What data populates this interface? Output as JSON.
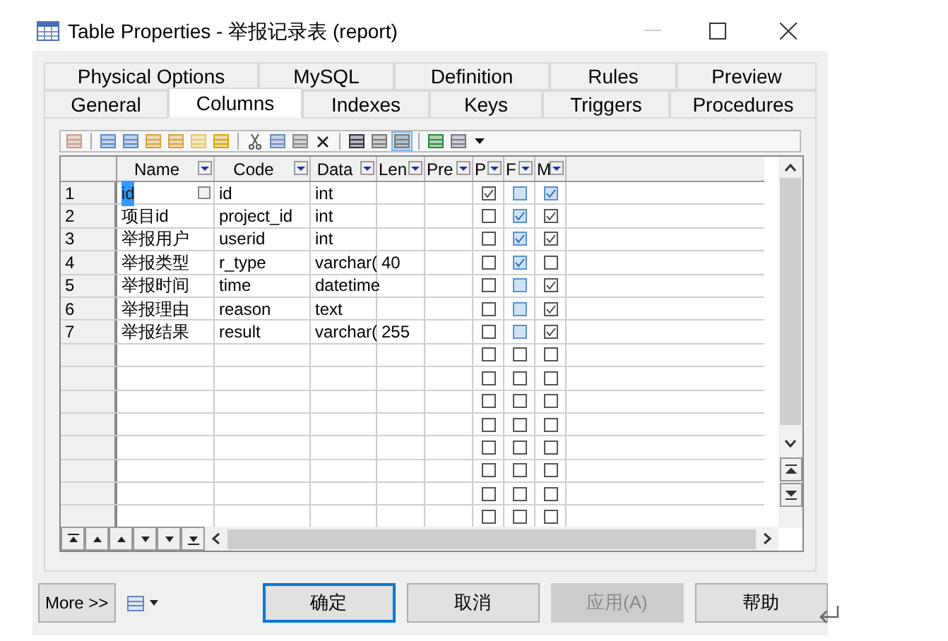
{
  "window": {
    "title": "Table Properties - 举报记录表 (report)"
  },
  "tab_rows": [
    [
      {
        "label": "Physical Options",
        "selected": false
      },
      {
        "label": "MySQL",
        "selected": false
      },
      {
        "label": "Definition",
        "selected": false
      },
      {
        "label": "Rules",
        "selected": false
      },
      {
        "label": "Preview",
        "selected": false
      }
    ],
    [
      {
        "label": "General",
        "selected": false
      },
      {
        "label": "Columns",
        "selected": true
      },
      {
        "label": "Indexes",
        "selected": false
      },
      {
        "label": "Keys",
        "selected": false
      },
      {
        "label": "Triggers",
        "selected": false
      },
      {
        "label": "Procedures",
        "selected": false
      }
    ]
  ],
  "toolbar": [
    {
      "pressed": false
    },
    {
      "pressed": false
    },
    {
      "pressed": false
    },
    {
      "pressed": false
    },
    {
      "pressed": false
    },
    {
      "pressed": false
    },
    {
      "pressed": false
    },
    {
      "pressed": false
    },
    {
      "pressed": false
    },
    {
      "pressed": false
    },
    {
      "pressed": false
    },
    {
      "pressed": false
    },
    {
      "pressed": false
    },
    {
      "pressed": true
    },
    {
      "pressed": false
    },
    {
      "pressed": false
    }
  ],
  "table": {
    "columns": [
      "Name",
      "Code",
      "Data",
      "Len",
      "Pre",
      "P",
      "F",
      "M"
    ],
    "rows": [
      {
        "kind": "column",
        "number": "1",
        "name": "id",
        "code": "id",
        "data": "int",
        "selected": true,
        "primary": true,
        "foreign": false,
        "mandatory": true
      },
      {
        "kind": "column",
        "number": "2",
        "name": "项目id",
        "code": "project_id",
        "data": "int",
        "selected": false,
        "primary": false,
        "foreign": true,
        "mandatory": true
      },
      {
        "kind": "column",
        "number": "3",
        "name": "举报用户",
        "code": "userid",
        "data": "int",
        "selected": false,
        "primary": false,
        "foreign": true,
        "mandatory": true
      },
      {
        "kind": "column",
        "number": "4",
        "name": "举报类型",
        "code": "r_type",
        "data": "varchar(",
        "length": "40",
        "selected": false,
        "primary": false,
        "foreign": true,
        "mandatory": false
      },
      {
        "kind": "column",
        "number": "5",
        "name": "举报时间",
        "code": "time",
        "data": "datetime",
        "selected": false,
        "primary": false,
        "foreign": false,
        "mandatory": true
      },
      {
        "kind": "column",
        "number": "6",
        "name": "举报理由",
        "code": "reason",
        "data": "text",
        "selected": false,
        "primary": false,
        "foreign": false,
        "mandatory": true
      },
      {
        "kind": "column",
        "number": "7",
        "name": "举报结果",
        "code": "result",
        "data": "varchar(",
        "length": "255",
        "selected": false,
        "primary": false,
        "foreign": false,
        "mandatory": true
      },
      {
        "kind": "blank",
        "primary": false,
        "foreign": false,
        "mandatory": false
      },
      {
        "kind": "blank",
        "primary": false,
        "foreign": false,
        "mandatory": false
      },
      {
        "kind": "blank",
        "primary": false,
        "foreign": false,
        "mandatory": false
      },
      {
        "kind": "blank",
        "primary": false,
        "foreign": false,
        "mandatory": false
      },
      {
        "kind": "blank",
        "primary": false,
        "foreign": false,
        "mandatory": false
      },
      {
        "kind": "blank",
        "primary": false,
        "foreign": false,
        "mandatory": false
      },
      {
        "kind": "blank",
        "primary": false,
        "foreign": false,
        "mandatory": false
      },
      {
        "kind": "blank",
        "primary": false,
        "foreign": false,
        "mandatory": false
      }
    ]
  },
  "more_button": "More >>",
  "buttons": [
    {
      "label": "确定",
      "kind": "default"
    },
    {
      "label": "取消",
      "kind": "normal"
    },
    {
      "label": "应用(A)",
      "kind": "disabled"
    },
    {
      "label": "帮助",
      "kind": "normal"
    }
  ]
}
